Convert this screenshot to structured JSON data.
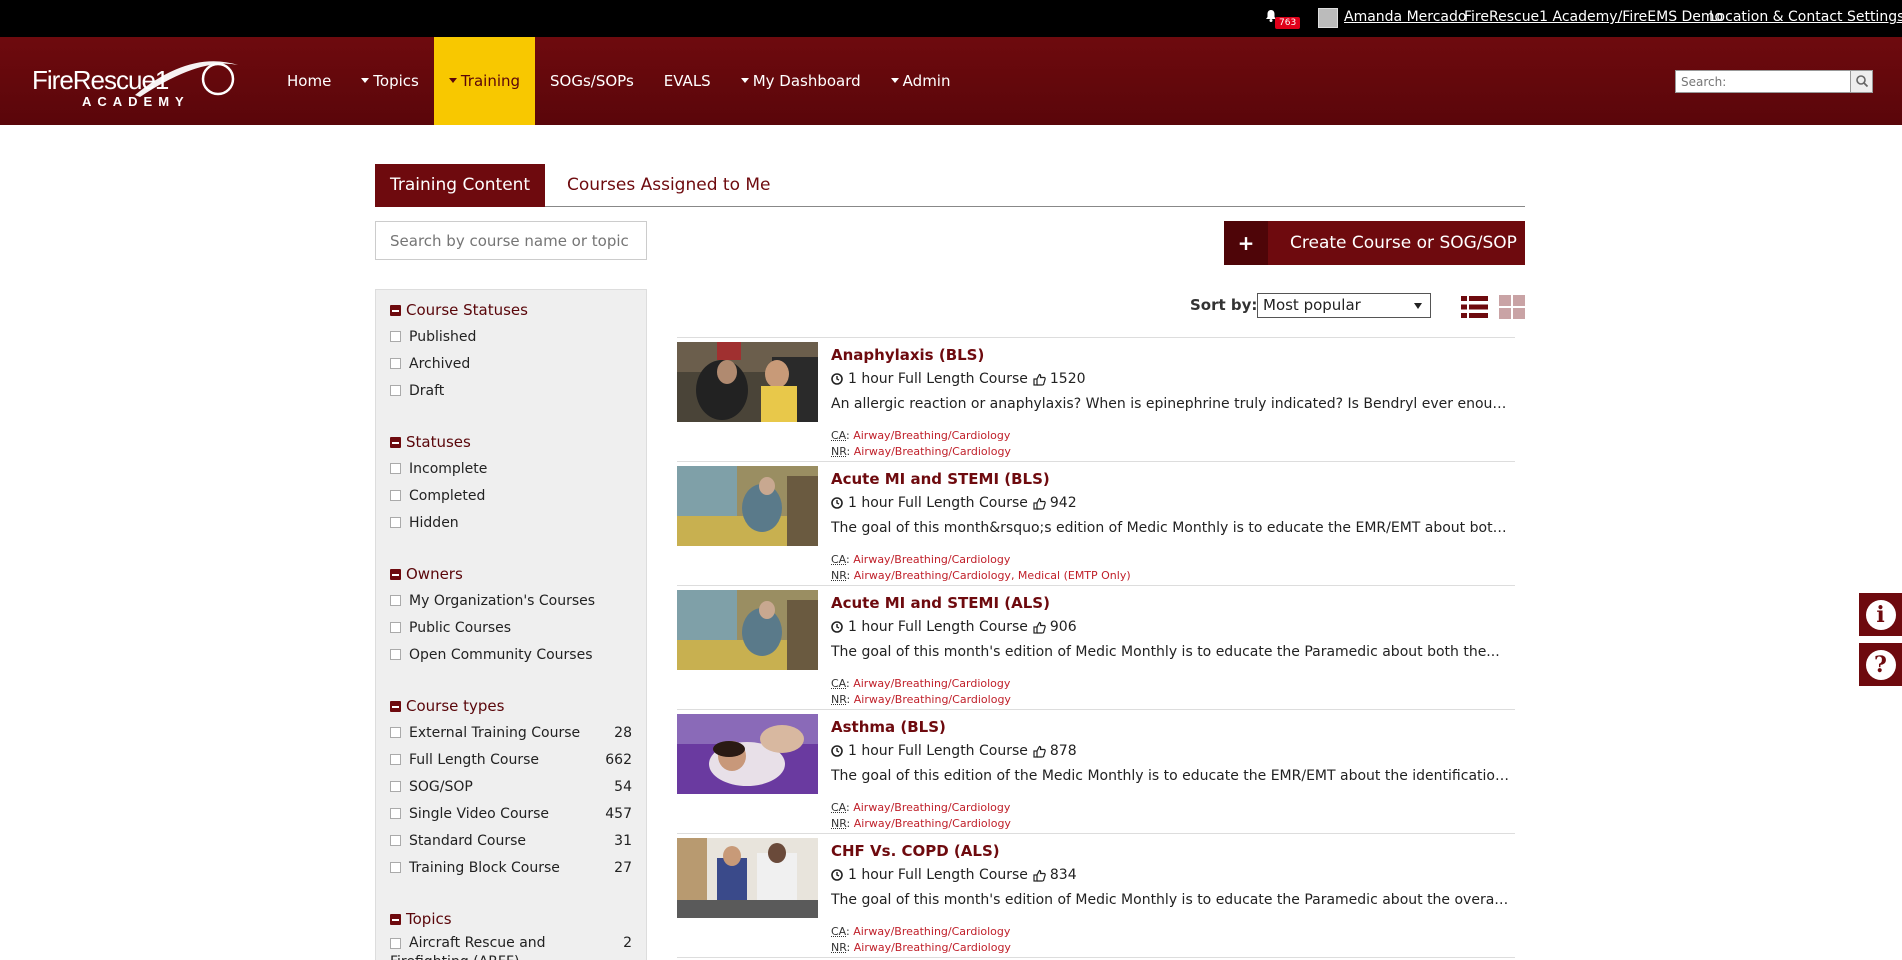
{
  "topbar": {
    "notification_count": "763",
    "user_name": "Amanda Mercado",
    "organization": "FireRescue1 Academy/FireEMS Demo",
    "location_settings": "Location & Contact Settings"
  },
  "logo": {
    "line1": "FireRescue1",
    "line2": "ACADEMY"
  },
  "nav": {
    "items": [
      {
        "label": "Home",
        "dropdown": false
      },
      {
        "label": "Topics",
        "dropdown": true
      },
      {
        "label": "Training",
        "dropdown": true,
        "active": true
      },
      {
        "label": "SOGs/SOPs",
        "dropdown": false
      },
      {
        "label": "EVALS",
        "dropdown": false
      },
      {
        "label": "My Dashboard",
        "dropdown": true
      },
      {
        "label": "Admin",
        "dropdown": true
      }
    ],
    "search_placeholder": "Search:"
  },
  "tabs": {
    "active": "Training Content",
    "other": "Courses Assigned to Me"
  },
  "course_search_placeholder": "Search by course name or topic",
  "create_button": "Create Course or SOG/SOP",
  "filters": {
    "course_statuses": {
      "title": "Course Statuses",
      "options": [
        "Published",
        "Archived",
        "Draft"
      ]
    },
    "statuses": {
      "title": "Statuses",
      "options": [
        "Incomplete",
        "Completed",
        "Hidden"
      ]
    },
    "owners": {
      "title": "Owners",
      "options": [
        "My Organization's Courses",
        "Public Courses",
        "Open Community Courses"
      ]
    },
    "course_types": {
      "title": "Course types",
      "options": [
        {
          "label": "External Training Course",
          "count": "28"
        },
        {
          "label": "Full Length Course",
          "count": "662"
        },
        {
          "label": "SOG/SOP",
          "count": "54"
        },
        {
          "label": "Single Video Course",
          "count": "457"
        },
        {
          "label": "Standard Course",
          "count": "31"
        },
        {
          "label": "Training Block Course",
          "count": "27"
        }
      ]
    },
    "topics": {
      "title": "Topics",
      "options": [
        {
          "label": "Aircraft Rescue and Firefighting (ARFF)",
          "count": "2"
        }
      ]
    }
  },
  "sort": {
    "label": "Sort by:",
    "selected": "Most popular"
  },
  "courses": [
    {
      "title": "Anaphylaxis (BLS)",
      "duration": "1 hour Full Length Course",
      "likes": "1520",
      "description": "An allergic reaction or anaphylaxis? When is epinephrine truly indicated? Is Bendryl ever enough...",
      "ca_label": "CA",
      "ca": "Airway/Breathing/Cardiology",
      "nr_label": "NR",
      "nr": "Airway/Breathing/Cardiology"
    },
    {
      "title": "Acute MI and STEMI (BLS)",
      "duration": "1 hour Full Length Course",
      "likes": "942",
      "description": "The goal of this month&rsquo;s edition of Medic Monthly is to educate the EMR/EMT about both...",
      "ca_label": "CA",
      "ca": "Airway/Breathing/Cardiology",
      "nr_label": "NR",
      "nr": "Airway/Breathing/Cardiology, Medical (EMTP Only)"
    },
    {
      "title": "Acute MI and STEMI (ALS)",
      "duration": "1 hour Full Length Course",
      "likes": "906",
      "description": "The goal of this month's edition of Medic Monthly is to educate the Paramedic about both the...",
      "ca_label": "CA",
      "ca": "Airway/Breathing/Cardiology",
      "nr_label": "NR",
      "nr": "Airway/Breathing/Cardiology"
    },
    {
      "title": "Asthma (BLS)",
      "duration": "1 hour Full Length Course",
      "likes": "878",
      "description": "The goal of this edition of the Medic Monthly is to educate the EMR/EMT about the identification...",
      "ca_label": "CA",
      "ca": "Airway/Breathing/Cardiology",
      "nr_label": "NR",
      "nr": "Airway/Breathing/Cardiology"
    },
    {
      "title": "CHF Vs. COPD (ALS)",
      "duration": "1 hour Full Length Course",
      "likes": "834",
      "description": "The goal of this month's edition of Medic Monthly is to educate the Paramedic about the overall...",
      "ca_label": "CA",
      "ca": "Airway/Breathing/Cardiology",
      "nr_label": "NR",
      "nr": "Airway/Breathing/Cardiology"
    }
  ],
  "widgets": {
    "info_icon": "i",
    "help_icon": "?"
  },
  "colors": {
    "brand": "#6e0a0e",
    "active_nav": "#f8c800",
    "tag_link": "#c0202a"
  }
}
